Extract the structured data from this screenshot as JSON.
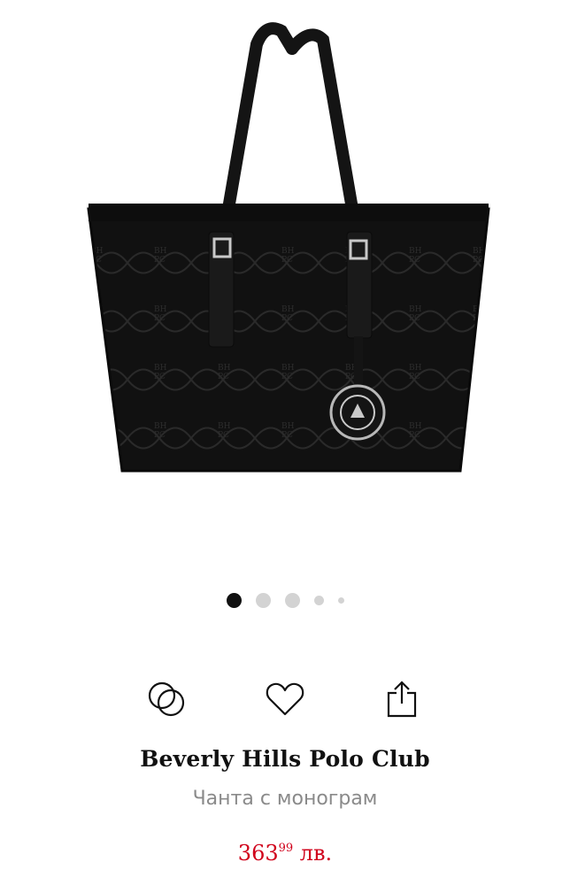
{
  "product": {
    "brand": "Beverly Hills Polo Club",
    "name": "Чанта с монограм",
    "price_main": "363",
    "price_cents": "99",
    "currency": "лв.",
    "price_color": "#d0021b",
    "monogram_text": "BH PC"
  },
  "gallery": {
    "image_count": 5,
    "active_index": 0
  },
  "actions": {
    "compare_icon": "compare-rings-icon",
    "wishlist_icon": "heart-icon",
    "share_icon": "share-icon"
  }
}
